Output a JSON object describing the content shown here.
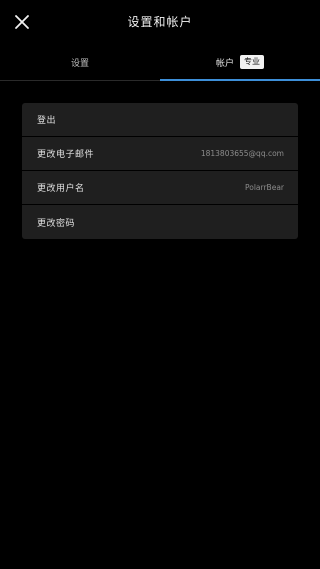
{
  "header": {
    "title": "设置和帐户",
    "close_icon": "close-icon"
  },
  "tabs": [
    {
      "label": "设置",
      "active": false
    },
    {
      "label": "帐户",
      "active": true,
      "badge": "专业"
    }
  ],
  "accent_color": "#3d8fd9",
  "account": {
    "rows": [
      {
        "label": "登出",
        "value": ""
      },
      {
        "label": "更改电子邮件",
        "value": "1813803655@qq.com"
      },
      {
        "label": "更改用户名",
        "value": "PolarrBear"
      },
      {
        "label": "更改密码",
        "value": ""
      }
    ]
  }
}
